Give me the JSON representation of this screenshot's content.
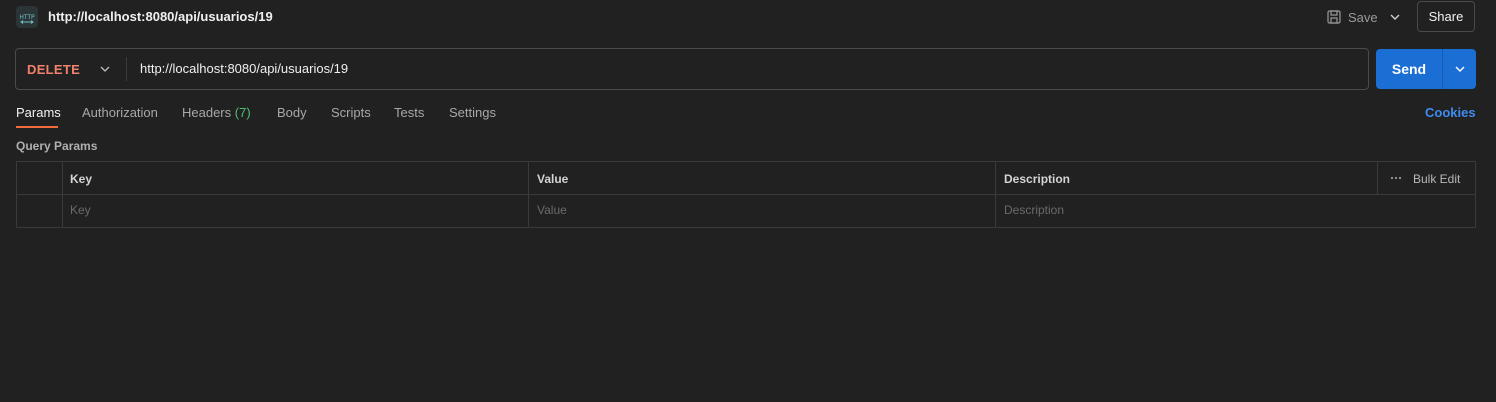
{
  "header": {
    "icon_text": "HTTP",
    "title": "http://localhost:8080/api/usuarios/19",
    "save_label": "Save",
    "share_label": "Share"
  },
  "request": {
    "method": "DELETE",
    "url": "http://localhost:8080/api/usuarios/19",
    "send_label": "Send"
  },
  "tabs": [
    {
      "label": "Params",
      "active": true
    },
    {
      "label": "Authorization"
    },
    {
      "label": "Headers",
      "count": "(7)"
    },
    {
      "label": "Body"
    },
    {
      "label": "Scripts"
    },
    {
      "label": "Tests"
    },
    {
      "label": "Settings"
    }
  ],
  "cookies_label": "Cookies",
  "query_params": {
    "title": "Query Params",
    "columns": {
      "key": "Key",
      "value": "Value",
      "description": "Description"
    },
    "bulk_edit_label": "Bulk Edit",
    "placeholders": {
      "key": "Key",
      "value": "Value",
      "description": "Description"
    }
  },
  "colors": {
    "background": "#212121",
    "method_delete": "#f0826d",
    "send_button": "#1b6ed4",
    "active_tab_underline": "#f26b3a",
    "headers_count": "#4bbf73",
    "cookies_link": "#3f8cf0"
  }
}
